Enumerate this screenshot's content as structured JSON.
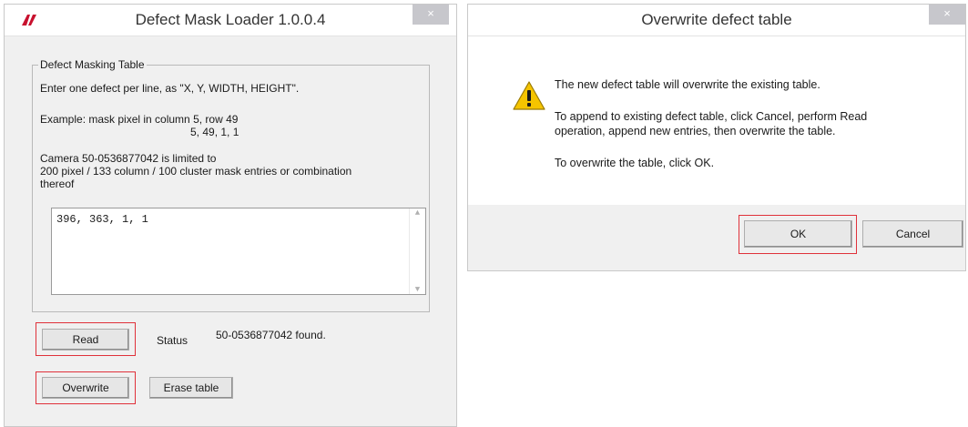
{
  "left_window": {
    "title": "Defect Mask Loader 1.0.0.4",
    "close_glyph": "×",
    "group": {
      "legend": "Defect Masking Table",
      "instruction": "Enter one defect per line, as  \"X, Y, WIDTH, HEIGHT\".",
      "example_line1": "Example: mask pixel in column 5, row 49",
      "example_line2": "5, 49, 1, 1",
      "limit_line1": "Camera 50-0536877042 is limited to",
      "limit_line2": "200 pixel / 133 column / 100 cluster mask entries or combination",
      "limit_line3": "thereof",
      "table_value": "396, 363, 1, 1"
    },
    "read_button": "Read",
    "status_label": "Status",
    "status_value": "50-0536877042 found.",
    "overwrite_button": "Overwrite",
    "erase_button": "Erase table"
  },
  "dialog": {
    "title": "Overwrite defect table",
    "close_glyph": "×",
    "message1": "The new defect table will overwrite the existing table.",
    "message2_line1": "To append to existing defect table, click Cancel, perform Read",
    "message2_line2": "operation, append new entries, then overwrite the table.",
    "message3": "To overwrite the table, click OK.",
    "ok_button": "OK",
    "cancel_button": "Cancel",
    "icon": "warning-icon"
  },
  "colors": {
    "highlight": "#e0313a",
    "logo": "#c8102e",
    "warning": "#f5c400"
  }
}
